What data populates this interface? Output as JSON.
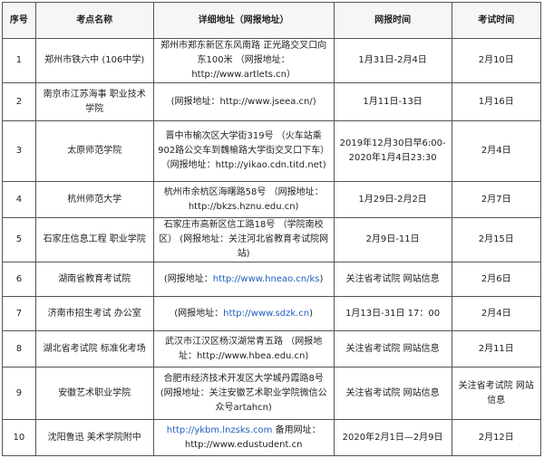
{
  "headers": {
    "no": "序号",
    "name": "考点名称",
    "address": "详细地址（网报地址）",
    "reg_time": "网报时间",
    "exam_time": "考试时间"
  },
  "rows": [
    {
      "no": "1",
      "name": "郑州市铁六中 (106中学)",
      "address": "郑州市郑东新区东风南路 正光路交叉口向东100米 （网报地址：http://www.artlets.cn）",
      "reg_time": "1月31日-2月4日",
      "exam_time": "2月10日"
    },
    {
      "no": "2",
      "name": "南京市江苏海事 职业技术学院",
      "address": "(网报地址：http://www.jseea.cn/)",
      "reg_time": "1月11日-13日",
      "exam_time": "1月16日"
    },
    {
      "no": "3",
      "name": "太原师范学院",
      "address": "晋中市榆次区大学街319号 （火车站乘902路公交车到魏榆路大学街交叉口下车） （网报地址：http://yikao.cdn.titd.net)",
      "reg_time": "2019年12月30日早6:00-2020年1月4日23:30",
      "exam_time": "2月4日"
    },
    {
      "no": "4",
      "name": "杭州师范大学",
      "address": "杭州市余杭区海曙路58号 （网报地址：http://bkzs.hznu.edu.cn)",
      "reg_time": "1月29日-2月2日",
      "exam_time": "2月7日"
    },
    {
      "no": "5",
      "name": "石家庄信息工程 职业学院",
      "address": "石家庄市高新区信工路18号 （学院南校区） (网报地址：关注河北省教育考试院网站)",
      "reg_time": "2月9日-11日",
      "exam_time": "2月15日"
    },
    {
      "no": "6",
      "name": "湖南省教育考试院",
      "address_label": "(网报地址：",
      "address_url": "http://www.hneao.cn/ks",
      "address_tail": ")",
      "reg_time": "关注省考试院 网站信息",
      "exam_time": "2月6日"
    },
    {
      "no": "7",
      "name": "济南市招生考试 办公室",
      "address_label": "(网报地址：",
      "address_url": "http://www.sdzk.cn",
      "address_tail": ")",
      "reg_time": "1月13日-31日 17：00",
      "exam_time": "2月4日"
    },
    {
      "no": "8",
      "name": "湖北省考试院 标准化考场",
      "address": "武汉市江汉区杨汉湖常青五路 （网报地址：http://www.hbea.edu.cn)",
      "reg_time": "关注省考试院 网站信息",
      "exam_time": "2月11日"
    },
    {
      "no": "9",
      "name": "安徽艺术职业学院",
      "address": "合肥市经济技术开发区大学城丹霞路8号 (网报地址：关注安徽艺术职业学院微信公众号artahcn)",
      "reg_time": "关注省考试院 网站信息",
      "exam_time": "关注省考试院 网站信息"
    },
    {
      "no": "10",
      "name": "沈阳鲁迅 美术学院附中",
      "address_url": "http://ykbm.lnzsks.com",
      "address_label": " 备用网址：http://www.edustudent.cn",
      "reg_time": "2020年2月1日—2月9日",
      "exam_time": "2月12日"
    }
  ]
}
